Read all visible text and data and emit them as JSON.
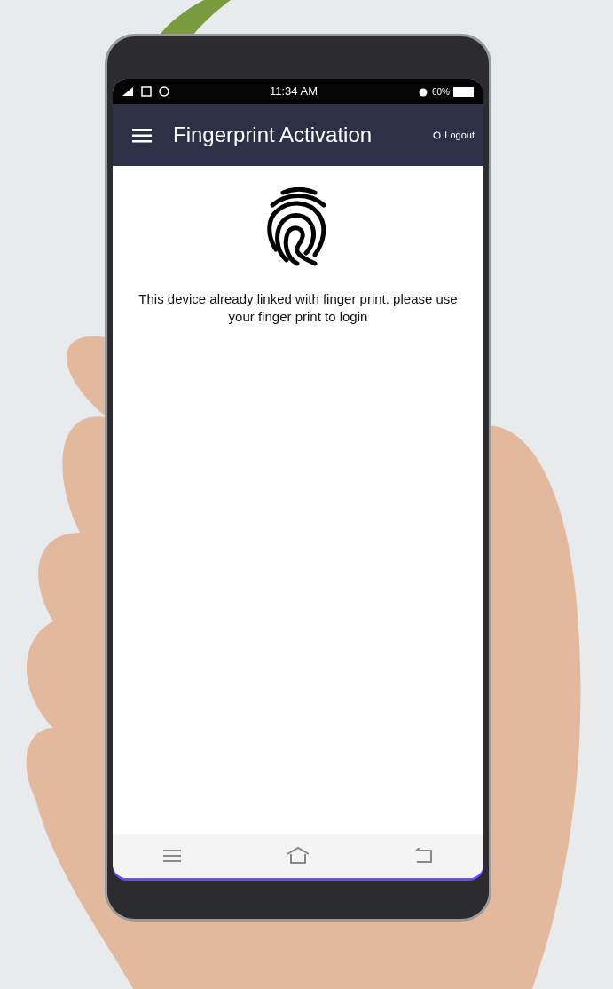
{
  "status_bar": {
    "time": "11:34 AM",
    "battery": "60%"
  },
  "app_bar": {
    "title": "Fingerprint Activation",
    "action": "Logout"
  },
  "message": "This device already linked with finger print. please use your finger print to login"
}
